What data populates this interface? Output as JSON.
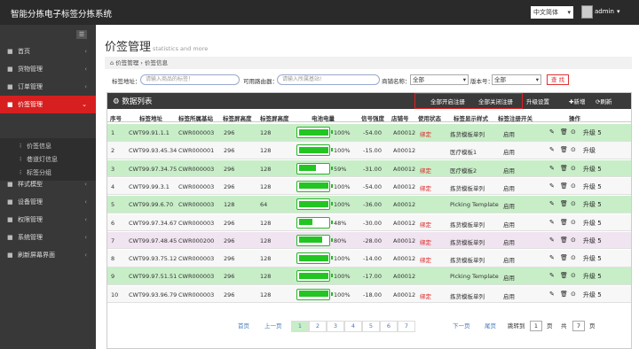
{
  "app": {
    "title": "智能分拣电子标签分拣系统",
    "lang": "中文简体",
    "user": "admin"
  },
  "sidebar": {
    "items": [
      {
        "label": "首页",
        "icon": "home-icon"
      },
      {
        "label": "货物管理",
        "icon": "box-icon"
      },
      {
        "label": "订单管理",
        "icon": "order-icon"
      },
      {
        "label": "价签管理",
        "icon": "tag-icon"
      },
      {
        "label": "智能货架",
        "icon": "shelf-icon"
      },
      {
        "label": "样式模型",
        "icon": "style-icon"
      },
      {
        "label": "设备管理",
        "icon": "device-icon"
      },
      {
        "label": "权限管理",
        "icon": "permission-icon"
      },
      {
        "label": "系统管理",
        "icon": "system-icon"
      },
      {
        "label": "刷新屏幕界面",
        "icon": "refresh-screen-icon"
      }
    ],
    "subitems": [
      "价签信息",
      "巷道灯信息",
      "标签分组"
    ]
  },
  "page": {
    "title": "价签管理",
    "subtitle": "statistics and more"
  },
  "breadcrumb": {
    "home": "价签管理",
    "current": "价签信息",
    "sep": "›"
  },
  "filters": {
    "tag_label": "标签地址：",
    "tag_placeholder": "请输入商品的标签！",
    "router_label": "可用路由器：",
    "router_placeholder": "请输入所属基站!",
    "template_label": "商铺名称：",
    "template_value": "全部",
    "version_label": "版本号：",
    "version_value": "全部",
    "search": "查 找"
  },
  "grid": {
    "title": "数据列表",
    "btn_open": "全部开启注册",
    "btn_close": "全部关闭注册",
    "btn_upgrade": "升级设置",
    "btn_add": "新增",
    "btn_refresh": "刷新",
    "headers": [
      "序号",
      "标签地址",
      "标签所属基站",
      "标签屏高度",
      "标签屏高度",
      "电池电量",
      "信号强度",
      "店铺号",
      "使用状态",
      "标签显示样式",
      "标签注册开关",
      "操作"
    ]
  },
  "rows": [
    {
      "idx": "1",
      "addr": "CWT99.91.1.1",
      "base": "CWR000003",
      "h": "296",
      "w": "128",
      "batt": 100,
      "pct": "100%",
      "sig": "-54.00",
      "shop": "A00012",
      "state": "绑定",
      "style": "拣货模板单列",
      "reg": "启用",
      "upgrade": "升级 5"
    },
    {
      "idx": "2",
      "addr": "CWT99.93.45.34",
      "base": "CWR000001",
      "h": "296",
      "w": "128",
      "batt": 100,
      "pct": "100%",
      "sig": "-15.00",
      "shop": "A00012",
      "state": "",
      "style": "医疗模板1",
      "reg": "启用",
      "upgrade": "升级"
    },
    {
      "idx": "3",
      "addr": "CWT99.97.34.75",
      "base": "CWR000003",
      "h": "296",
      "w": "128",
      "batt": 59,
      "pct": "59%",
      "sig": "-31.00",
      "shop": "A00012",
      "state": "绑定",
      "style": "医疗模板2",
      "reg": "启用",
      "upgrade": "升级 5"
    },
    {
      "idx": "4",
      "addr": "CWT99.99.3.1",
      "base": "CWR000003",
      "h": "296",
      "w": "128",
      "batt": 100,
      "pct": "100%",
      "sig": "-54.00",
      "shop": "A00012",
      "state": "绑定",
      "style": "拣货模板单列",
      "reg": "启用",
      "upgrade": "升级 5"
    },
    {
      "idx": "5",
      "addr": "CWT99.99.6.70",
      "base": "CWR000003",
      "h": "128",
      "w": "64",
      "batt": 100,
      "pct": "100%",
      "sig": "-36.00",
      "shop": "A00012",
      "state": "",
      "style": "Picking Template",
      "reg": "启用",
      "upgrade": "升级 5"
    },
    {
      "idx": "6",
      "addr": "CWT99.97.34.67",
      "base": "CWR000003",
      "h": "296",
      "w": "128",
      "batt": 48,
      "pct": "48%",
      "sig": "-30.00",
      "shop": "A00012",
      "state": "绑定",
      "style": "拣货模板单列",
      "reg": "启用",
      "upgrade": "升级 5"
    },
    {
      "idx": "7",
      "addr": "CWT99.97.48.45",
      "base": "CWR000200",
      "h": "296",
      "w": "128",
      "batt": 80,
      "pct": "80%",
      "sig": "-28.00",
      "shop": "A00012",
      "state": "绑定",
      "style": "拣货模板单列",
      "reg": "启用",
      "upgrade": "升级 5"
    },
    {
      "idx": "8",
      "addr": "CWT99.93.75.12",
      "base": "CWR000003",
      "h": "296",
      "w": "128",
      "batt": 100,
      "pct": "100%",
      "sig": "-14.00",
      "shop": "A00012",
      "state": "绑定",
      "style": "拣货模板单列",
      "reg": "启用",
      "upgrade": "升级 5"
    },
    {
      "idx": "9",
      "addr": "CWT99.97.51.51",
      "base": "CWR000003",
      "h": "296",
      "w": "128",
      "batt": 100,
      "pct": "100%",
      "sig": "-17.00",
      "shop": "A00012",
      "state": "",
      "style": "Picking Template",
      "reg": "启用",
      "upgrade": "升级 5"
    },
    {
      "idx": "10",
      "addr": "CWT99.93.96.79",
      "base": "CWR000003",
      "h": "296",
      "w": "128",
      "batt": 100,
      "pct": "100%",
      "sig": "-18.00",
      "shop": "A00012",
      "state": "绑定",
      "style": "拣货模板单列",
      "reg": "启用",
      "upgrade": "升级 5"
    }
  ],
  "pager": {
    "first": "首页",
    "prev": "上一页",
    "pages": [
      "1",
      "2",
      "3",
      "4",
      "5",
      "6",
      "7"
    ],
    "next": "下一页",
    "last": "尾页",
    "jump": "跳转到",
    "jump_val": "1",
    "page_unit": "页",
    "total_prefix": "共",
    "total": "7",
    "total_unit": "页"
  }
}
